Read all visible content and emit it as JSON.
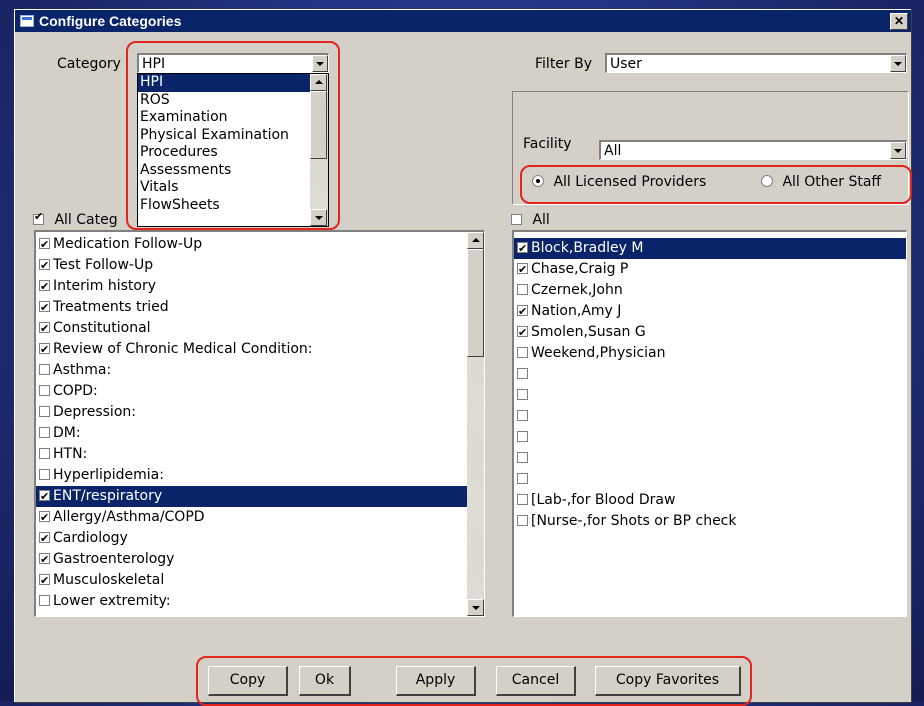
{
  "window": {
    "title": "Configure Categories",
    "close_glyph": "✕"
  },
  "category": {
    "label": "Category",
    "value": "HPI",
    "options": [
      "HPI",
      "ROS",
      "Examination",
      "Physical Examination",
      "Procedures",
      "Assessments",
      "Vitals",
      "FlowSheets"
    ],
    "selected_index": 0
  },
  "filter": {
    "label": "Filter By",
    "value": "User"
  },
  "facility": {
    "label": "Facility",
    "value": "All"
  },
  "radios": {
    "licensed": {
      "label": "All Licensed Providers",
      "checked": true
    },
    "other": {
      "label": "All Other Staff",
      "checked": false
    }
  },
  "all_categories": {
    "label": "All Categ",
    "checked": true
  },
  "categories_list": [
    {
      "label": "Medication Follow-Up",
      "checked": true
    },
    {
      "label": "Test Follow-Up",
      "checked": true
    },
    {
      "label": "Interim history",
      "checked": true
    },
    {
      "label": "Treatments tried",
      "checked": true
    },
    {
      "label": "Constitutional",
      "checked": true
    },
    {
      "label": "Review of Chronic Medical Condition:",
      "checked": true
    },
    {
      "label": "Asthma:",
      "checked": false
    },
    {
      "label": "COPD:",
      "checked": false
    },
    {
      "label": "Depression:",
      "checked": false
    },
    {
      "label": "DM:",
      "checked": false
    },
    {
      "label": "HTN:",
      "checked": false
    },
    {
      "label": "Hyperlipidemia:",
      "checked": false
    },
    {
      "label": "ENT/respiratory",
      "checked": true,
      "selected": true
    },
    {
      "label": "Allergy/Asthma/COPD",
      "checked": true
    },
    {
      "label": "Cardiology",
      "checked": true
    },
    {
      "label": "Gastroenterology",
      "checked": true
    },
    {
      "label": "Musculoskeletal",
      "checked": true
    },
    {
      "label": "Lower extremity:",
      "checked": false
    }
  ],
  "all_users": {
    "label": "All",
    "checked": false
  },
  "users_list": [
    {
      "label": "Block,Bradley M",
      "checked": true,
      "selected": true
    },
    {
      "label": "Chase,Craig P",
      "checked": true
    },
    {
      "label": "Czernek,John",
      "checked": false
    },
    {
      "label": "Nation,Amy J",
      "checked": true
    },
    {
      "label": "Smolen,Susan G",
      "checked": true
    },
    {
      "label": "Weekend,Physician",
      "checked": false
    },
    {
      "label": "",
      "checked": false
    },
    {
      "label": "",
      "checked": false
    },
    {
      "label": "",
      "checked": false
    },
    {
      "label": "",
      "checked": false
    },
    {
      "label": "",
      "checked": false
    },
    {
      "label": "",
      "checked": false
    },
    {
      "label": "[Lab-,for Blood Draw",
      "checked": false
    },
    {
      "label": "[Nurse-,for Shots or BP check",
      "checked": false
    }
  ],
  "buttons": {
    "copy": "Copy",
    "ok": "Ok",
    "apply": "Apply",
    "cancel": "Cancel",
    "copy_favorites": "Copy Favorites"
  },
  "colors": {
    "highlight": "#e3241b",
    "selection": "#0a246a",
    "face": "#d4d0c8"
  }
}
